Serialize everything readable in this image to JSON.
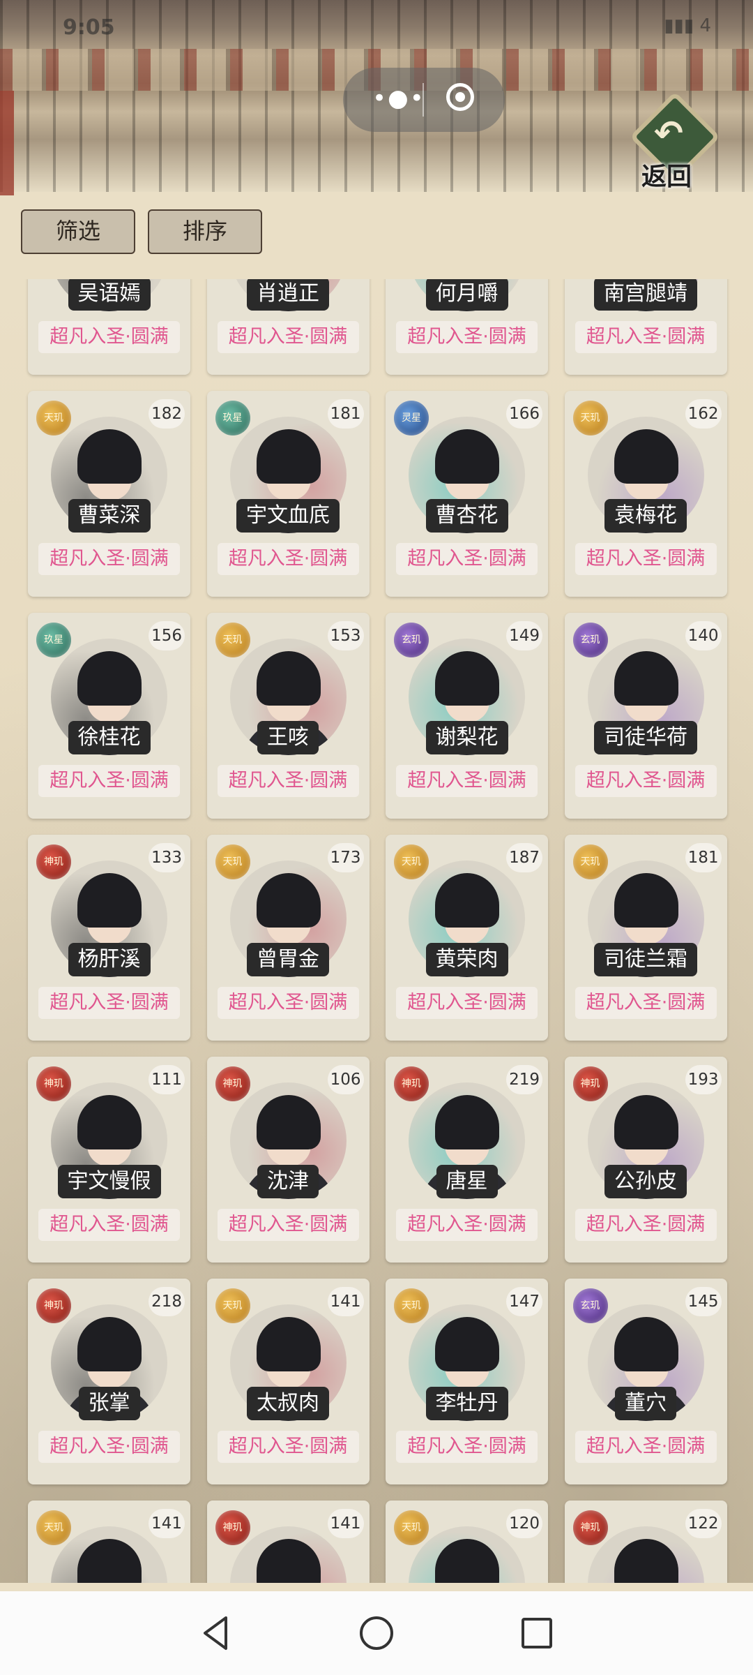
{
  "status_bar": {
    "time": "9:05",
    "right": "4"
  },
  "header": {
    "back_label": "返回"
  },
  "controls": {
    "filter_label": "筛选",
    "sort_label": "排序"
  },
  "colors": {
    "rank_text": "#e0568f",
    "element_gold": "#d99a2b",
    "element_teal": "#3f8f7e",
    "element_blue": "#2e5ea8",
    "element_purple": "#6b3fa0",
    "element_red": "#b52e22"
  },
  "cards": [
    {
      "name": "吴语嫣",
      "count": "",
      "element": "",
      "element_color": "purple",
      "rank": "超凡入圣·圆满"
    },
    {
      "name": "肖逍正",
      "count": "",
      "element": "",
      "element_color": "gold",
      "rank": "超凡入圣·圆满"
    },
    {
      "name": "何月嚼",
      "count": "",
      "element": "",
      "element_color": "gold",
      "rank": "超凡入圣·圆满"
    },
    {
      "name": "南宫腿靖",
      "count": "",
      "element": "",
      "element_color": "gold",
      "rank": "超凡入圣·圆满"
    },
    {
      "name": "曹菜深",
      "count": "182",
      "element": "天玑",
      "element_color": "gold",
      "rank": "超凡入圣·圆满"
    },
    {
      "name": "宇文血㡳",
      "count": "181",
      "element": "玖星",
      "element_color": "teal",
      "rank": "超凡入圣·圆满"
    },
    {
      "name": "曹杏花",
      "count": "166",
      "element": "灵星",
      "element_color": "blue",
      "rank": "超凡入圣·圆满"
    },
    {
      "name": "袁梅花",
      "count": "162",
      "element": "天玑",
      "element_color": "gold",
      "rank": "超凡入圣·圆满"
    },
    {
      "name": "徐桂花",
      "count": "156",
      "element": "玖星",
      "element_color": "teal",
      "rank": "超凡入圣·圆满"
    },
    {
      "name": "王咳",
      "count": "153",
      "element": "天玑",
      "element_color": "gold",
      "rank": "超凡入圣·圆满"
    },
    {
      "name": "谢梨花",
      "count": "149",
      "element": "玄玑",
      "element_color": "purple",
      "rank": "超凡入圣·圆满"
    },
    {
      "name": "司徒华荷",
      "count": "140",
      "element": "玄玑",
      "element_color": "purple",
      "rank": "超凡入圣·圆满"
    },
    {
      "name": "杨肝溪",
      "count": "133",
      "element": "神玑",
      "element_color": "red",
      "rank": "超凡入圣·圆满"
    },
    {
      "name": "曾胃金",
      "count": "173",
      "element": "天玑",
      "element_color": "gold",
      "rank": "超凡入圣·圆满"
    },
    {
      "name": "黄荣肉",
      "count": "187",
      "element": "天玑",
      "element_color": "gold",
      "rank": "超凡入圣·圆满"
    },
    {
      "name": "司徒兰霜",
      "count": "181",
      "element": "天玑",
      "element_color": "gold",
      "rank": "超凡入圣·圆满"
    },
    {
      "name": "宇文慢假",
      "count": "111",
      "element": "神玑",
      "element_color": "red",
      "rank": "超凡入圣·圆满"
    },
    {
      "name": "沈津",
      "count": "106",
      "element": "神玑",
      "element_color": "red",
      "rank": "超凡入圣·圆满"
    },
    {
      "name": "唐星",
      "count": "219",
      "element": "神玑",
      "element_color": "red",
      "rank": "超凡入圣·圆满"
    },
    {
      "name": "公孙皮",
      "count": "193",
      "element": "神玑",
      "element_color": "red",
      "rank": "超凡入圣·圆满"
    },
    {
      "name": "张掌",
      "count": "218",
      "element": "神玑",
      "element_color": "red",
      "rank": "超凡入圣·圆满"
    },
    {
      "name": "太叔肉",
      "count": "141",
      "element": "天玑",
      "element_color": "gold",
      "rank": "超凡入圣·圆满"
    },
    {
      "name": "李牡丹",
      "count": "147",
      "element": "天玑",
      "element_color": "gold",
      "rank": "超凡入圣·圆满"
    },
    {
      "name": "董穴",
      "count": "145",
      "element": "玄玑",
      "element_color": "purple",
      "rank": "超凡入圣·圆满"
    },
    {
      "name": "",
      "count": "141",
      "element": "天玑",
      "element_color": "gold",
      "rank": ""
    },
    {
      "name": "",
      "count": "141",
      "element": "神玑",
      "element_color": "red",
      "rank": ""
    },
    {
      "name": "",
      "count": "120",
      "element": "天玑",
      "element_color": "gold",
      "rank": ""
    },
    {
      "name": "",
      "count": "122",
      "element": "神玑",
      "element_color": "red",
      "rank": ""
    }
  ]
}
